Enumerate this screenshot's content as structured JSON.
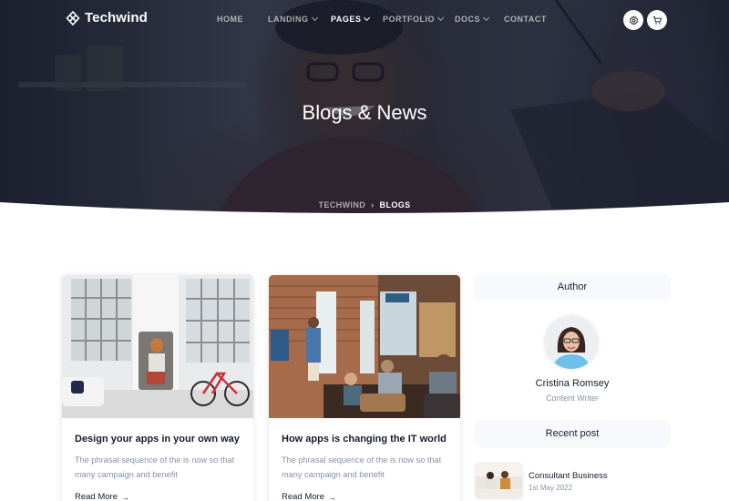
{
  "brand": {
    "name": "Techwind"
  },
  "nav": {
    "items": [
      {
        "label": "HOME",
        "dropdown": false,
        "active": false
      },
      {
        "label": "LANDING",
        "dropdown": true,
        "active": false
      },
      {
        "label": "PAGES",
        "dropdown": true,
        "active": true
      },
      {
        "label": "PORTFOLIO",
        "dropdown": true,
        "active": false
      },
      {
        "label": "DOCS",
        "dropdown": true,
        "active": false
      },
      {
        "label": "CONTACT",
        "dropdown": false,
        "active": false
      }
    ],
    "icons": [
      "settings-icon",
      "cart-icon"
    ]
  },
  "hero": {
    "title": "Blogs & News",
    "breadcrumb": [
      {
        "label": "TECHWIND"
      },
      {
        "label": "BLOGS"
      }
    ]
  },
  "posts": [
    {
      "title": "Design your apps in your own way",
      "excerpt": "The phrasal sequence of the is now so that many campaign and benefit",
      "link_label": "Read More"
    },
    {
      "title": "How apps is changing the IT world",
      "excerpt": "The phrasal sequence of the is now so that many campaign and benefit",
      "link_label": "Read More"
    }
  ],
  "sidebar": {
    "author": {
      "heading": "Author",
      "name": "Cristina Romsey",
      "role": "Content Writer"
    },
    "recent": {
      "heading": "Recent post",
      "items": [
        {
          "title": "Consultant Business",
          "date": "1st May 2022"
        }
      ]
    }
  },
  "colors": {
    "text_dark": "#161c2d",
    "text_muted": "#8492a6",
    "hero_overlay": "#161c2d",
    "widget_bg": "#f8f9fc"
  }
}
